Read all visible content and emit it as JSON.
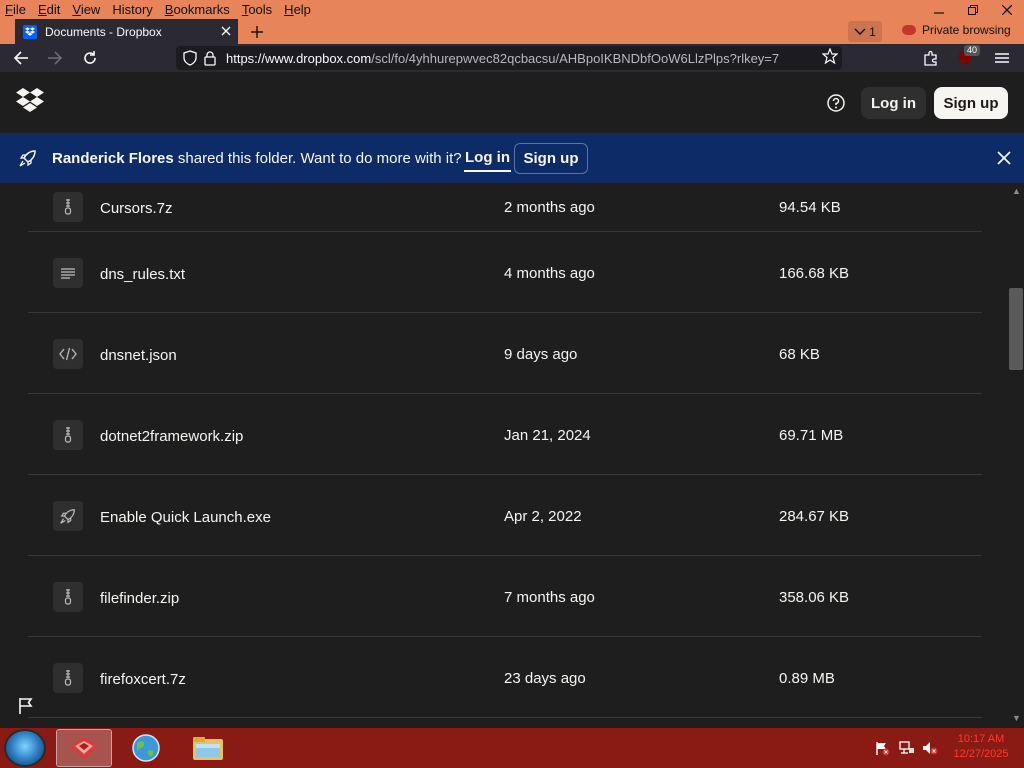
{
  "browser": {
    "menu": [
      {
        "label": "File",
        "key": "F",
        "rest": "ile"
      },
      {
        "label": "Edit",
        "key": "E",
        "rest": "dit"
      },
      {
        "label": "View",
        "key": "V",
        "rest": "iew"
      },
      {
        "label": "History",
        "key": "",
        "rest": "History"
      },
      {
        "label": "Bookmarks",
        "key": "B",
        "rest": "ookmarks"
      },
      {
        "label": "Tools",
        "key": "T",
        "rest": "ools"
      },
      {
        "label": "Help",
        "key": "H",
        "rest": "elp"
      }
    ],
    "tab_title": "Documents - Dropbox",
    "tab_count": "1",
    "private_label": "Private browsing",
    "url_host": "https://www.dropbox.com",
    "url_path": "/scl/fo/4yhhurepwvec82qcbacsu/AHBpoIKBNDbfOoW6LlzPlps?rlkey=7",
    "extension_badge": "40",
    "accent_color": "#e8845a"
  },
  "header": {
    "login_label": "Log in",
    "signup_label": "Sign up"
  },
  "banner": {
    "owner": "Randerick Flores",
    "message": " shared this folder. Want to do more with it?",
    "login_label": "Log in",
    "signup_label": "Sign up"
  },
  "files": [
    {
      "name": "Cursors.7z",
      "modified": "2 months ago",
      "size": "94.54 KB",
      "icon": "zip-icon"
    },
    {
      "name": "dns_rules.txt",
      "modified": "4 months ago",
      "size": "166.68 KB",
      "icon": "text-file-icon"
    },
    {
      "name": "dnsnet.json",
      "modified": "9 days ago",
      "size": "68 KB",
      "icon": "code-file-icon"
    },
    {
      "name": "dotnet2framework.zip",
      "modified": "Jan 21, 2024",
      "size": "69.71 MB",
      "icon": "zip-icon"
    },
    {
      "name": "Enable Quick Launch.exe",
      "modified": "Apr 2, 2022",
      "size": "284.67 KB",
      "icon": "executable-icon"
    },
    {
      "name": "filefinder.zip",
      "modified": "7 months ago",
      "size": "358.06 KB",
      "icon": "zip-icon"
    },
    {
      "name": "firefoxcert.7z",
      "modified": "23 days ago",
      "size": "0.89 MB",
      "icon": "zip-icon"
    }
  ],
  "taskbar": {
    "time": "10:17 AM",
    "date": "12/27/2025"
  }
}
